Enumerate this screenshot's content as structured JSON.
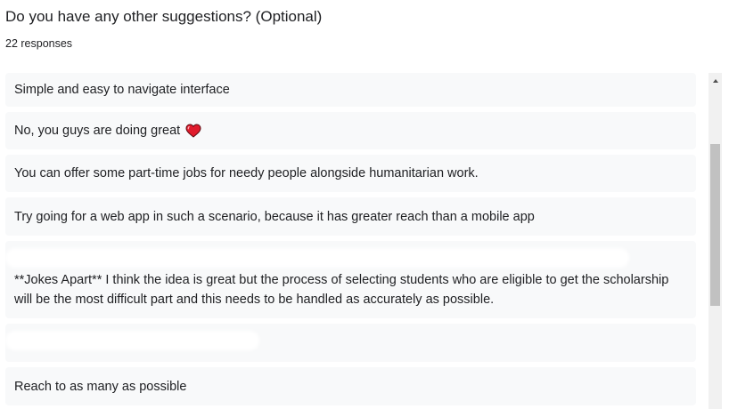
{
  "question": {
    "title": "Do you have any other suggestions? (Optional)",
    "response_count": "22 responses"
  },
  "responses": [
    {
      "text": "Simple and easy to navigate interface"
    },
    {
      "text": "No, you guys are doing great",
      "emoji": "heart-icon"
    },
    {
      "text": "You can offer some part-time jobs for needy people alongside humanitarian work."
    },
    {
      "text": "Try going for a web app in such a scenario, because it has greater reach than a mobile app"
    },
    {
      "text": "**Jokes Apart** I think the idea is great but the process of selecting students who are eligible to get the scholarship will be the most difficult part and this needs to be handled as accurately as possible."
    },
    {
      "text": ""
    },
    {
      "text": "Reach to as many as possible"
    }
  ],
  "colors": {
    "card_bg": "#f8f9fa",
    "text": "#202124",
    "heart": "#e01b2c",
    "scroll_track": "#f1f1f1",
    "scroll_thumb": "#c1c1c1"
  }
}
